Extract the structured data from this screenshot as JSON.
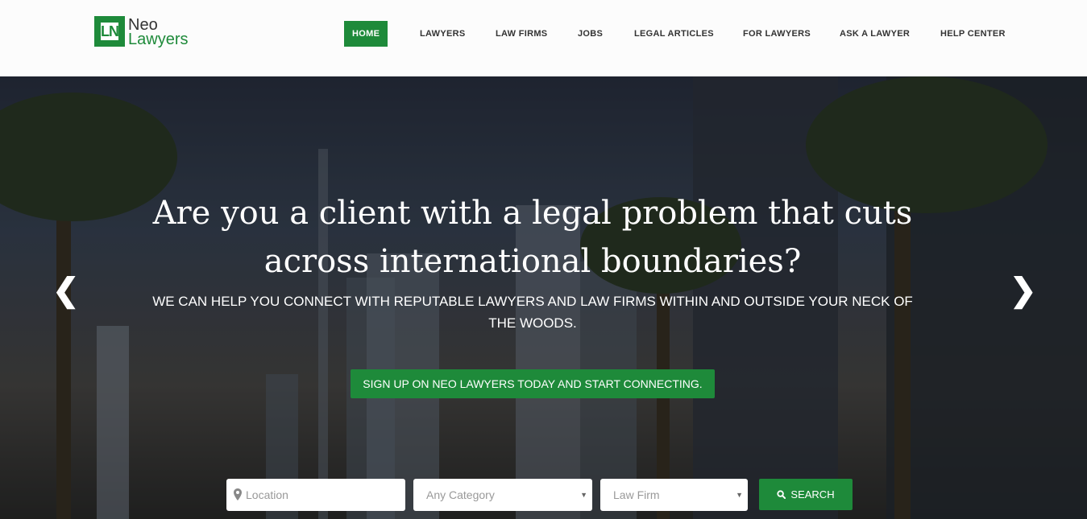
{
  "brand": {
    "mark": "LN",
    "name_line1": "Neo",
    "name_line2": "Lawyers",
    "color": "#1e8a3a"
  },
  "nav": {
    "items": [
      {
        "label": "HOME",
        "active": true
      },
      {
        "label": "LAWYERS"
      },
      {
        "label": "LAW FIRMS"
      },
      {
        "label": "JOBS"
      },
      {
        "label": "LEGAL ARTICLES"
      },
      {
        "label": "FOR LAWYERS"
      },
      {
        "label": "ASK A LAWYER"
      },
      {
        "label": "HELP CENTER"
      }
    ]
  },
  "hero": {
    "headline": "Are you a client with a legal problem that cuts across international boundaries?",
    "subline": "WE CAN HELP YOU CONNECT WITH REPUTABLE LAWYERS AND LAW FIRMS WITHIN AND OUTSIDE YOUR NECK OF THE WOODS.",
    "cta_label": "SIGN UP ON NEO LAWYERS TODAY AND START CONNECTING.",
    "prev_icon": "chevron-left-icon",
    "next_icon": "chevron-right-icon"
  },
  "search": {
    "location_placeholder": "Location",
    "category_value": "Any Category",
    "law_firm_value": "Law Firm",
    "button_label": "SEARCH",
    "location_icon": "map-pin-icon",
    "button_icon": "search-icon"
  }
}
